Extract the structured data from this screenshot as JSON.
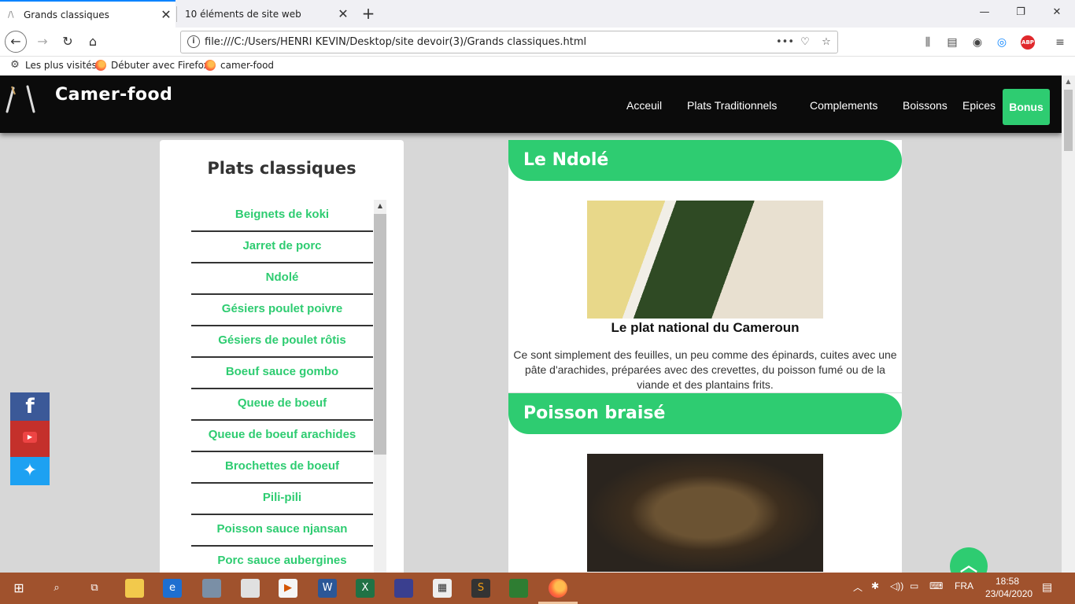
{
  "browser": {
    "tabs": [
      {
        "title": "Grands classiques"
      },
      {
        "title": "10 éléments de site web"
      }
    ],
    "url": "file:///C:/Users/HENRI KEVIN/Desktop/site devoir(3)/Grands classiques.html",
    "bookmarks": [
      "Les plus visités",
      "Débuter avec Firefox",
      "camer-food"
    ],
    "toolbar_icons": [
      "library-icon",
      "reader-icon",
      "account-icon",
      "extension-icon",
      "adblock-icon",
      "menu-icon"
    ],
    "abp_label": "ABP"
  },
  "site": {
    "brand": "Camer-food",
    "menu": [
      "Acceuil",
      "Plats Traditionnels",
      "Complements",
      "Boissons",
      "Epices"
    ],
    "bonus": "Bonus"
  },
  "sidebar": {
    "title": "Plats classiques",
    "items": [
      "Beignets de koki",
      "Jarret de porc",
      "Ndolé",
      "Gésiers poulet poivre",
      "Gésiers de poulet rôtis",
      "Boeuf sauce gombo",
      "Queue de boeuf",
      "Queue de boeuf arachides",
      "Brochettes de boeuf",
      "Pili-pili",
      "Poisson sauce njansan",
      "Porc sauce aubergines"
    ]
  },
  "social": {
    "facebook": "f",
    "youtube": "▶",
    "twitter": "🐦"
  },
  "sections": [
    {
      "title": "Le Ndolé",
      "subtitle": "Le plat national du Cameroun",
      "description": "Ce sont simplement des feuilles, un peu comme des épinards, cuites avec une pâte d'arachides, préparées avec des crevettes, du poisson fumé ou de la viande et des plantains frits."
    },
    {
      "title": "Poisson braisé"
    }
  ],
  "taskbar": {
    "language": "FRA",
    "time": "18:58",
    "date": "23/04/2020"
  },
  "colors": {
    "accent": "#2ecc71",
    "header_bg": "#0b0b0b",
    "taskbar_bg": "#a0522d",
    "facebook": "#3b5998",
    "youtube": "#c4302b",
    "twitter": "#1da1f2"
  }
}
